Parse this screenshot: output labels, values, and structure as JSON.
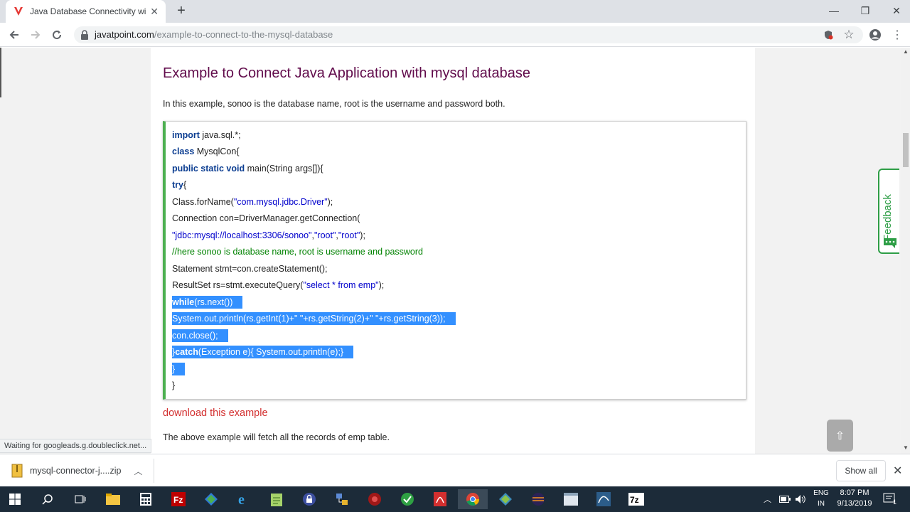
{
  "browser": {
    "tab_title": "Java Database Connectivity with",
    "url_host": "javatpoint.com",
    "url_path": "/example-to-connect-to-the-mysql-database"
  },
  "page": {
    "heading": "Example to Connect Java Application with mysql database",
    "intro": "In this example, sonoo is the database name, root is the username and password both.",
    "download_link": "download this example",
    "after_text": "The above example will fetch all the records of emp table.",
    "feedback_label": "Feedback",
    "scroll_top_icon": "⇧"
  },
  "code": {
    "l1_kw": "import",
    "l1_rest": " java.sql.*;",
    "l2_kw": "class",
    "l2_rest": " MysqlCon{",
    "l3_kw": "public static void",
    "l3_rest": " main(String args[]){",
    "l4_kw": "try",
    "l4_rest": "{",
    "l5_a": "Class.forName(",
    "l5_str": "\"com.mysql.jdbc.Driver\"",
    "l5_b": ");",
    "l6": "Connection con=DriverManager.getConnection(",
    "l7_s1": "\"jdbc:mysql://localhost:3306/sonoo\"",
    "l7_c1": ",",
    "l7_s2": "\"root\"",
    "l7_c2": ",",
    "l7_s3": "\"root\"",
    "l7_end": ");",
    "l8_comment": "//here sonoo is database name, root is username and password",
    "l9": "Statement stmt=con.createStatement();",
    "l10_a": "ResultSet rs=stmt.executeQuery(",
    "l10_str": "\"select * from emp\"",
    "l10_b": ");",
    "l11_kw": "while",
    "l11_rest": "(rs.next())",
    "l12": "System.out.println(rs.getInt(1)+\"  \"+rs.getString(2)+\"  \"+rs.getString(3));",
    "l13": "con.close();",
    "l14_a": "}",
    "l14_kw": "catch",
    "l14_rest": "(Exception e){ System.out.println(e);}",
    "l15": "}",
    "l16": "}"
  },
  "status": {
    "text": "Waiting for googleads.g.doubleclick.net..."
  },
  "download_shelf": {
    "file_name": "mysql-connector-j....zip",
    "show_all": "Show all"
  },
  "taskbar": {
    "lang_line1": "ENG",
    "lang_line2": "IN",
    "time": "8:07 PM",
    "date": "9/13/2019",
    "notifications_count": "1"
  },
  "colors": {
    "heading": "#610b4b",
    "code_border": "#4caf50",
    "selection": "#3390ff",
    "link_red": "#d32f2f",
    "feedback_green": "#2e9e46"
  }
}
